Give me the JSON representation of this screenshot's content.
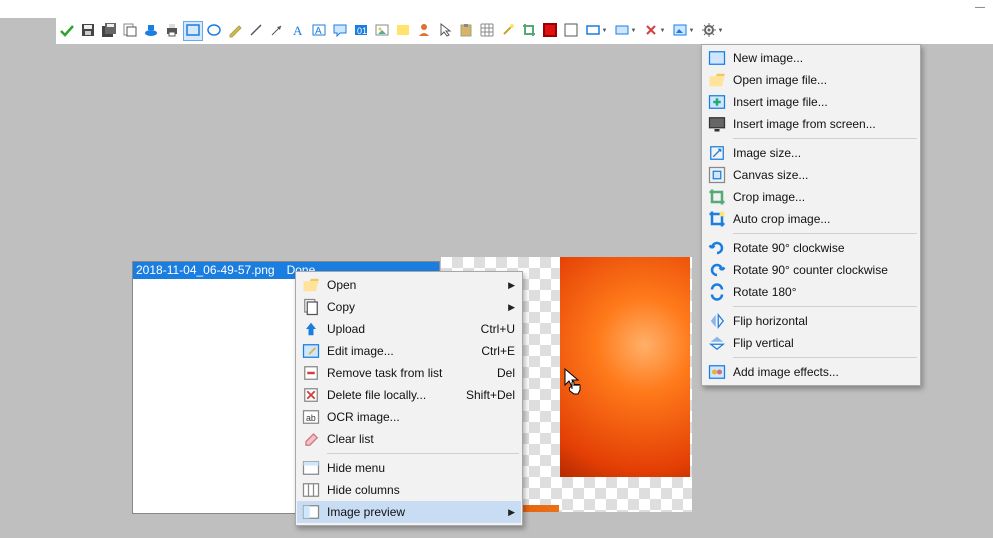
{
  "toolbar_icons": [
    "confirm-icon",
    "save-icon",
    "save-all-icon",
    "copy-icon",
    "upload-icon",
    "print-icon",
    "rectangle-select-icon",
    "ellipse-select-icon",
    "pencil-icon",
    "line-icon",
    "arrow-icon",
    "text-icon",
    "textbox-icon",
    "speech-icon",
    "counter-icon",
    "image-icon",
    "highlight-icon",
    "person-icon",
    "pointer-icon",
    "paste-icon",
    "grid-icon",
    "magic-icon",
    "crop-icon",
    "fill-red-icon",
    "fill-white-icon",
    "draw-outline-icon",
    "draw-fill-icon",
    "draw-effects-icon",
    "image-menu-icon",
    "settings-icon"
  ],
  "toolbar_active_index": 6,
  "toolbar_dropdown_indices": [
    25,
    26,
    27,
    28,
    29
  ],
  "task": {
    "filename": "2018-11-04_06-49-57.png",
    "status": "Done"
  },
  "context_menu": [
    {
      "icon": "folder-open-icon",
      "label": "Open",
      "submenu": true
    },
    {
      "icon": "pages-icon",
      "label": "Copy",
      "submenu": true
    },
    {
      "icon": "upload-arrow-icon",
      "label": "Upload",
      "shortcut": "Ctrl+U"
    },
    {
      "icon": "edit-image-icon",
      "label": "Edit image...",
      "shortcut": "Ctrl+E"
    },
    {
      "icon": "remove-task-icon",
      "label": "Remove task from list",
      "shortcut": "Del"
    },
    {
      "icon": "delete-file-icon",
      "label": "Delete file locally...",
      "shortcut": "Shift+Del"
    },
    {
      "icon": "ocr-icon",
      "label": "OCR image..."
    },
    {
      "icon": "eraser-icon",
      "label": "Clear list"
    },
    {
      "sep": true
    },
    {
      "icon": "hide-menu-icon",
      "label": "Hide menu"
    },
    {
      "icon": "columns-icon",
      "label": "Hide columns"
    },
    {
      "icon": "preview-icon",
      "label": "Image preview",
      "submenu": true,
      "highlight": true
    }
  ],
  "image_menu": [
    {
      "icon": "new-image-icon",
      "label": "New image..."
    },
    {
      "icon": "open-file-icon",
      "label": "Open image file..."
    },
    {
      "icon": "insert-image-icon",
      "label": "Insert image file..."
    },
    {
      "icon": "screen-icon",
      "label": "Insert image from screen..."
    },
    {
      "sep": true
    },
    {
      "icon": "image-size-icon",
      "label": "Image size..."
    },
    {
      "icon": "canvas-size-icon",
      "label": "Canvas size..."
    },
    {
      "icon": "crop-tool-icon",
      "label": "Crop image..."
    },
    {
      "icon": "autocrop-icon",
      "label": "Auto crop image..."
    },
    {
      "sep": true
    },
    {
      "icon": "rotate-cw-icon",
      "label": "Rotate 90° clockwise"
    },
    {
      "icon": "rotate-ccw-icon",
      "label": "Rotate 90° counter clockwise"
    },
    {
      "icon": "rotate180-icon",
      "label": "Rotate 180°"
    },
    {
      "sep": true
    },
    {
      "icon": "flip-h-icon",
      "label": "Flip horizontal"
    },
    {
      "icon": "flip-v-icon",
      "label": "Flip vertical"
    },
    {
      "sep": true
    },
    {
      "icon": "effects-icon",
      "label": "Add image effects..."
    }
  ]
}
